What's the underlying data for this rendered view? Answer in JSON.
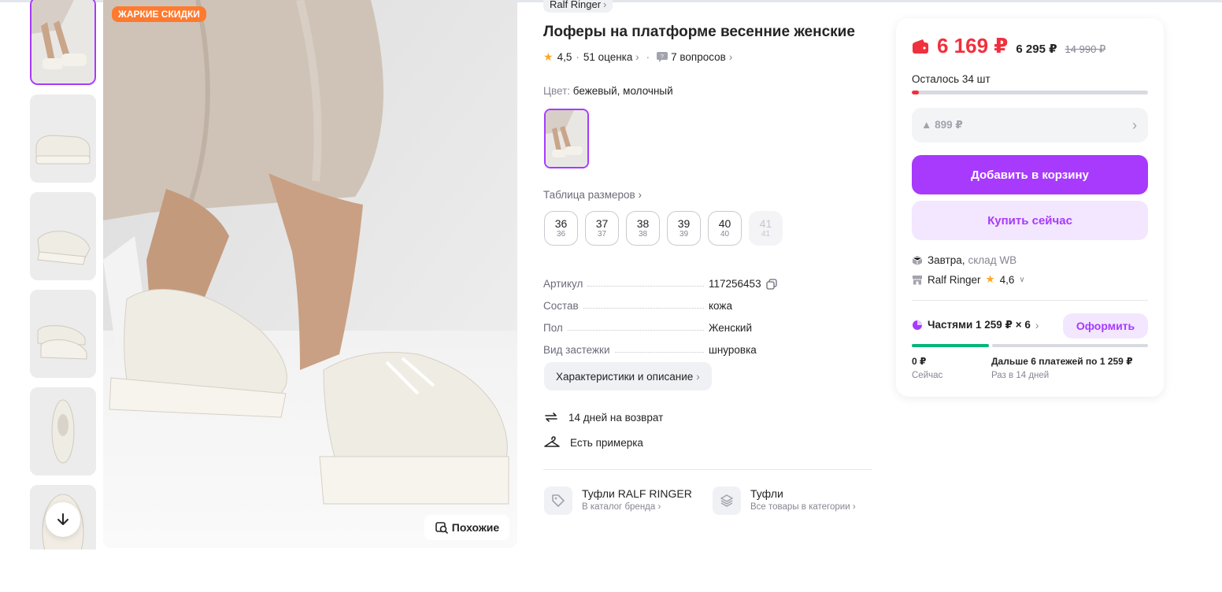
{
  "gallery": {
    "promo_badge": "ЖАРКИЕ СКИДКИ",
    "similar_label": "Похожие",
    "thumbnails": [
      "look-photo",
      "loafer-side",
      "loafer-angle",
      "loafer-pair",
      "loafer-top",
      "sole-detail"
    ]
  },
  "product": {
    "brand": "Ralf Ringer",
    "title": "Лоферы на платформе весенние женские",
    "rating": "4,5",
    "reviews": "51 оценка",
    "questions": "7 вопросов",
    "color_label": "Цвет:",
    "color_value": "бежевый, молочный",
    "size_table_label": "Таблица размеров",
    "sizes": [
      {
        "big": "36",
        "small": "36",
        "available": true
      },
      {
        "big": "37",
        "small": "37",
        "available": true
      },
      {
        "big": "38",
        "small": "38",
        "available": true
      },
      {
        "big": "39",
        "small": "39",
        "available": true
      },
      {
        "big": "40",
        "small": "40",
        "available": true
      },
      {
        "big": "41",
        "small": "41",
        "available": false
      }
    ],
    "params": [
      {
        "key": "Артикул",
        "value": "117256453"
      },
      {
        "key": "Состав",
        "value": "кожа"
      },
      {
        "key": "Пол",
        "value": "Женский"
      },
      {
        "key": "Вид застежки",
        "value": "шнуровка"
      }
    ],
    "characteristics_button": "Характеристики и описание",
    "features": [
      "14 дней на возврат",
      "Есть примерка"
    ],
    "categories": [
      {
        "title": "Туфли RALF RINGER",
        "sub": "В каталог бренда"
      },
      {
        "title": "Туфли",
        "sub": "Все товары в категории"
      }
    ]
  },
  "buy_panel": {
    "price": "6 169 ₽",
    "price_mid": "6 295 ₽",
    "price_old": "14 990 ₽",
    "stock_text": "Осталось 34 шт",
    "stock_fraction": 0.03,
    "coupon": "▲ 899 ₽",
    "add_to_cart": "Добавить в корзину",
    "buy_now": "Купить сейчас",
    "delivery": "Завтра,",
    "warehouse": "склад WB",
    "seller": "Ralf Ringer",
    "seller_rating": "4,6",
    "installments": "Частями 1 259 ₽ × 6",
    "order_button": "Оформить",
    "now_amount": "0 ₽",
    "now_label": "Сейчас",
    "later_amount": "Дальше 6 платежей по 1 259 ₽",
    "later_label": "Раз в 14 дней"
  },
  "colors": {
    "accent": "#a73afd",
    "price_red": "#f0303c",
    "promo_orange": "#ff7a2f",
    "star": "#ffa726",
    "installment_green": "#00b67a"
  }
}
